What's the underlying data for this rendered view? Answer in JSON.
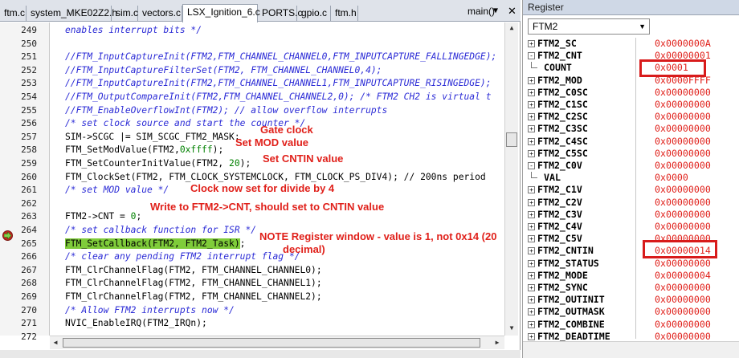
{
  "tabs": [
    {
      "label": "ftm.c"
    },
    {
      "label": "system_MKE02Z2.h"
    },
    {
      "label": "sim.c"
    },
    {
      "label": "vectors.c"
    },
    {
      "label": "LSX_Ignition_6.c"
    },
    {
      "label": "PORTS.c"
    },
    {
      "label": "gpio.c"
    },
    {
      "label": "ftm.h"
    }
  ],
  "function_selector": {
    "value": "main()",
    "dropdown_icon": "triangle-down-icon",
    "close_icon": "close-icon"
  },
  "code_lines": [
    {
      "num": "249",
      "text": "enables interrupt bits */"
    },
    {
      "num": "250",
      "text": ""
    },
    {
      "num": "251",
      "text": "//FTM_InputCaptureInit(FTM2,FTM_CHANNEL_CHANNEL0,FTM_INPUTCAPTURE_FALLINGEDGE);"
    },
    {
      "num": "252",
      "text": "//FTM_InputCaptureFilterSet(FTM2, FTM_CHANNEL_CHANNEL0,4);"
    },
    {
      "num": "253",
      "text": "//FTM_InputCaptureInit(FTM2,FTM_CHANNEL_CHANNEL1,FTM_INPUTCAPTURE_RISINGEDGE);"
    },
    {
      "num": "254",
      "text": "//FTM_OutputCompareInit(FTM2,FTM_CHANNEL_CHANNEL2,0); /* FTM2 CH2 is virtual t"
    },
    {
      "num": "255",
      "text": "//FTM_EnableOverflowInt(FTM2); // allow overflow interrupts"
    },
    {
      "num": "256",
      "text": "/* set clock source and start the counter */"
    },
    {
      "num": "257",
      "text": "SIM->SCGC |= SIM_SCGC_FTM2_MASK;"
    },
    {
      "num": "258",
      "pre": "FTM_SetModValue(FTM2,",
      "numlit": "0xffff",
      "post": ");"
    },
    {
      "num": "259",
      "pre": "FTM_SetCounterInitValue(FTM2, ",
      "numlit": "20",
      "post": ");"
    },
    {
      "num": "260",
      "text": "FTM_ClockSet(FTM2, FTM_CLOCK_SYSTEMCLOCK, FTM_CLOCK_PS_DIV4); // 200ns period"
    },
    {
      "num": "261",
      "text": "/* set MOD value */"
    },
    {
      "num": "262",
      "text": ""
    },
    {
      "num": "263",
      "pre": "FTM2->CNT = ",
      "numlit": "0",
      "post": ";"
    },
    {
      "num": "264",
      "text": "/* set callback function for ISR */"
    },
    {
      "num": "265",
      "hl": "FTM_SetCallback(FTM2, FTM2_Task)",
      "post": ";"
    },
    {
      "num": "266",
      "text": "/* clear any pending FTM2 interrupt flag */"
    },
    {
      "num": "267",
      "text": "FTM_ClrChannelFlag(FTM2, FTM_CHANNEL_CHANNEL0);"
    },
    {
      "num": "268",
      "text": "FTM_ClrChannelFlag(FTM2, FTM_CHANNEL_CHANNEL1);"
    },
    {
      "num": "269",
      "text": "FTM_ClrChannelFlag(FTM2, FTM_CHANNEL_CHANNEL2);"
    },
    {
      "num": "270",
      "text": "/* Allow FTM2 interrupts now */"
    },
    {
      "num": "271",
      "text": "NVIC_EnableIRQ(FTM2_IRQn);"
    },
    {
      "num": "272",
      "text": ""
    }
  ],
  "annotations": {
    "gate_clock": "Gate clock",
    "set_mod": "Set MOD value",
    "set_cntin": "Set CNTIN value",
    "clock_divide": "Clock now set for divide by 4",
    "write_cnt": "Write to FTM2->CNT, should set to CNTIN value",
    "note_line1": "NOTE Register window - value is 1, not 0x14 (20",
    "note_line2": "decimal)"
  },
  "register_panel": {
    "title": "Register",
    "selected_peripheral": "FTM2",
    "rows": [
      {
        "name": "FTM2_SC",
        "value": "0x0000000A",
        "expander": "+"
      },
      {
        "name": "FTM2_CNT",
        "value": "0x00000001",
        "expander": "-"
      },
      {
        "name": "COUNT",
        "value": "0x0001",
        "child": true
      },
      {
        "name": "FTM2_MOD",
        "value": "0x0000FFFF",
        "expander": "+"
      },
      {
        "name": "FTM2_C0SC",
        "value": "0x00000000",
        "expander": "+"
      },
      {
        "name": "FTM2_C1SC",
        "value": "0x00000000",
        "expander": "+"
      },
      {
        "name": "FTM2_C2SC",
        "value": "0x00000000",
        "expander": "+"
      },
      {
        "name": "FTM2_C3SC",
        "value": "0x00000000",
        "expander": "+"
      },
      {
        "name": "FTM2_C4SC",
        "value": "0x00000000",
        "expander": "+"
      },
      {
        "name": "FTM2_C5SC",
        "value": "0x00000000",
        "expander": "+"
      },
      {
        "name": "FTM2_C0V",
        "value": "0x00000000",
        "expander": "-"
      },
      {
        "name": "VAL",
        "value": "0x0000",
        "child": true
      },
      {
        "name": "FTM2_C1V",
        "value": "0x00000000",
        "expander": "+"
      },
      {
        "name": "FTM2_C2V",
        "value": "0x00000000",
        "expander": "+"
      },
      {
        "name": "FTM2_C3V",
        "value": "0x00000000",
        "expander": "+"
      },
      {
        "name": "FTM2_C4V",
        "value": "0x00000000",
        "expander": "+"
      },
      {
        "name": "FTM2_C5V",
        "value": "0x00000000",
        "expander": "+"
      },
      {
        "name": "FTM2_CNTIN",
        "value": "0x00000014",
        "expander": "+"
      },
      {
        "name": "FTM2_STATUS",
        "value": "0x00000000",
        "expander": "+"
      },
      {
        "name": "FTM2_MODE",
        "value": "0x00000004",
        "expander": "+"
      },
      {
        "name": "FTM2_SYNC",
        "value": "0x00000000",
        "expander": "+"
      },
      {
        "name": "FTM2_OUTINIT",
        "value": "0x00000000",
        "expander": "+"
      },
      {
        "name": "FTM2_OUTMASK",
        "value": "0x00000000",
        "expander": "+"
      },
      {
        "name": "FTM2_COMBINE",
        "value": "0x00000000",
        "expander": "+"
      },
      {
        "name": "FTM2_DEADTIME",
        "value": "0x00000000",
        "expander": "+"
      }
    ]
  },
  "colors": {
    "annotation_red": "#e0201a",
    "comment_blue": "#2b2bd6",
    "highlight_green": "#7fcc3a"
  }
}
